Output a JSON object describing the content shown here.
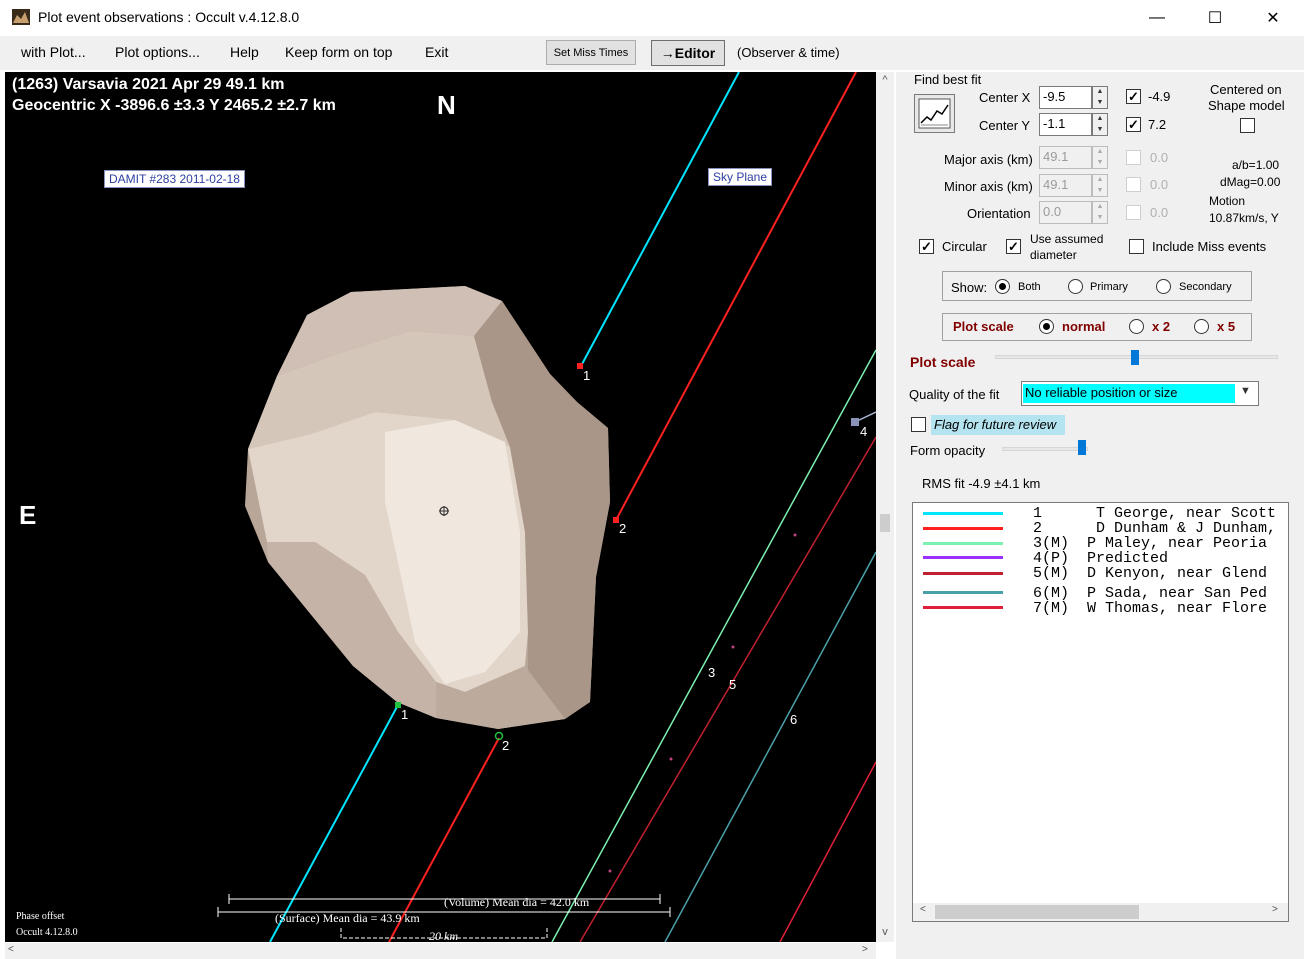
{
  "window": {
    "title": "Plot event observations : Occult v.4.12.8.0",
    "controls": {
      "minimize": "—",
      "maximize": "☐",
      "close": "✕"
    }
  },
  "menu": {
    "with_plot": "with Plot...",
    "plot_options": "Plot options...",
    "help": "Help",
    "keep_on_top": "Keep form on top",
    "exit": "Exit",
    "set_miss_times": "Set Miss Times",
    "editor": "→Editor",
    "observer_time": "(Observer & time)"
  },
  "plot": {
    "title": "(1263) Varsavia  2021 Apr 29  49.1 km",
    "geocentric": "Geocentric X  -3896.6 ±3.3  Y 2465.2 ±2.7 km",
    "north": "N",
    "east": "E",
    "damit_label": "DAMIT #283 2011-02-18",
    "sky_plane": "Sky Plane",
    "volume_dia": "(Volume) Mean dia = 42.0 km",
    "surface_dia": "(Surface) Mean dia = 43.9 km",
    "scale_bar": "20  km",
    "phase_offset": "Phase offset",
    "occult_version": "Occult 4.12.8.0",
    "chord_labels": [
      "1",
      "2",
      "3",
      "4",
      "5",
      "6",
      "1",
      "2"
    ]
  },
  "panel": {
    "find_best_fit": "Find best fit",
    "center_x_label": "Center X",
    "center_x_value": "-9.5",
    "center_x_check": "-4.9",
    "center_y_label": "Center Y",
    "center_y_value": "-1.1",
    "center_y_check": "7.2",
    "centered_on": "Centered on",
    "shape_model": "Shape model",
    "major_axis_label": "Major axis (km)",
    "major_axis_value": "49.1",
    "major_axis_check": "0.0",
    "minor_axis_label": "Minor axis (km)",
    "minor_axis_value": "49.1",
    "minor_axis_check": "0.0",
    "orientation_label": "Orientation",
    "orientation_value": "0.0",
    "orientation_check": "0.0",
    "ab_ratio": "a/b=1.00",
    "dmag": "dMag=0.00",
    "motion_label": "Motion",
    "motion_value": "10.87km/s, Y",
    "circular": "Circular",
    "use_assumed_1": "Use assumed",
    "use_assumed_2": "diameter",
    "include_miss": "Include Miss events",
    "show_label": "Show:",
    "show_both": "Both",
    "show_primary": "Primary",
    "show_secondary": "Secondary",
    "plot_scale_group": "Plot scale",
    "scale_normal": "normal",
    "scale_x2": "x 2",
    "scale_x5": "x 5",
    "plot_scale_slider_label": "Plot scale",
    "quality_label": "Quality of the fit",
    "quality_value": "No reliable position or size",
    "flag_review": "Flag for future review",
    "form_opacity": "Form opacity",
    "rms_fit": "RMS fit -4.9 ±4.1 km"
  },
  "legend": [
    {
      "text": "1      T George, near Scott",
      "color": "#00e5ff"
    },
    {
      "text": "2      D Dunham & J Dunham,",
      "color": "#ff2020"
    },
    {
      "text": "3(M)  P Maley, near Peoria",
      "color": "#7cf0b0"
    },
    {
      "text": "4(P)  Predicted",
      "color": "#9b30ff"
    },
    {
      "text": "5(M)  D Kenyon, near Glend",
      "color": "#c02030"
    },
    {
      "text": "6(M)  P Sada, near San Ped",
      "color": "#4aa0a8"
    },
    {
      "text": "7(M)  W Thomas, near Flore",
      "color": "#e0203a"
    }
  ],
  "colors": {
    "plot_bg": "#000000",
    "asteroid": "#d9c9bc",
    "quality_highlight": "#00ffff",
    "accent_red": "#800000"
  },
  "scrollbar": {
    "up": "^",
    "down": "v",
    "left": "<",
    "right": ">"
  }
}
